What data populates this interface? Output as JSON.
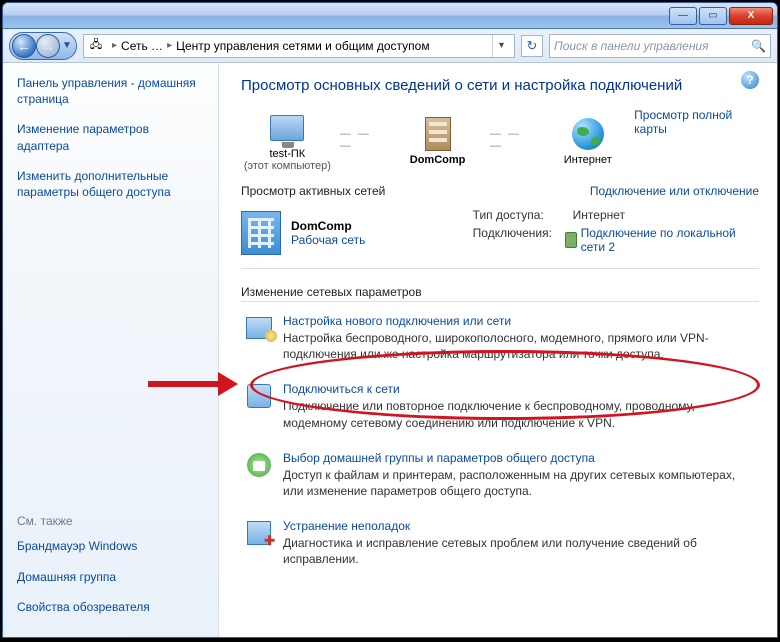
{
  "titlebar": {
    "min": "—",
    "max": "▭",
    "close": "X"
  },
  "breadcrumb": {
    "seg1": "Сеть …",
    "seg2": "Центр управления сетями и общим доступом"
  },
  "search": {
    "placeholder": "Поиск в панели управления"
  },
  "sidebar": {
    "links": [
      "Панель управления - домашняя страница",
      "Изменение параметров адаптера",
      "Изменить дополнительные параметры общего доступа"
    ],
    "also_title": "См. также",
    "also": [
      "Брандмауэр Windows",
      "Домашняя группа",
      "Свойства обозревателя"
    ]
  },
  "main": {
    "heading": "Просмотр основных сведений о сети и настройка подключений",
    "map_link": "Просмотр полной карты",
    "nodes": {
      "pc": {
        "name": "test-ПК",
        "sub": "(этот компьютер)"
      },
      "gw": {
        "name": "DomComp"
      },
      "net": {
        "name": "Интернет"
      }
    },
    "active_title": "Просмотр активных сетей",
    "active_link": "Подключение или отключение",
    "active": {
      "name": "DomComp",
      "type": "Рабочая сеть",
      "access_label": "Тип доступа:",
      "access_value": "Интернет",
      "conn_label": "Подключения:",
      "conn_value": "Подключение по локальной сети 2"
    },
    "change_title": "Изменение сетевых параметров",
    "tasks": [
      {
        "title": "Настройка нового подключения или сети",
        "desc": "Настройка беспроводного, широкополосного, модемного, прямого или VPN-подключения или же настройка маршрутизатора или точки доступа."
      },
      {
        "title": "Подключиться к сети",
        "desc": "Подключение или повторное подключение к беспроводному, проводному, модемному сетевому соединению или подключение к VPN."
      },
      {
        "title": "Выбор домашней группы и параметров общего доступа",
        "desc": "Доступ к файлам и принтерам, расположенным на других сетевых компьютерах, или изменение параметров общего доступа."
      },
      {
        "title": "Устранение неполадок",
        "desc": "Диагностика и исправление сетевых проблем или получение сведений об исправлении."
      }
    ]
  }
}
